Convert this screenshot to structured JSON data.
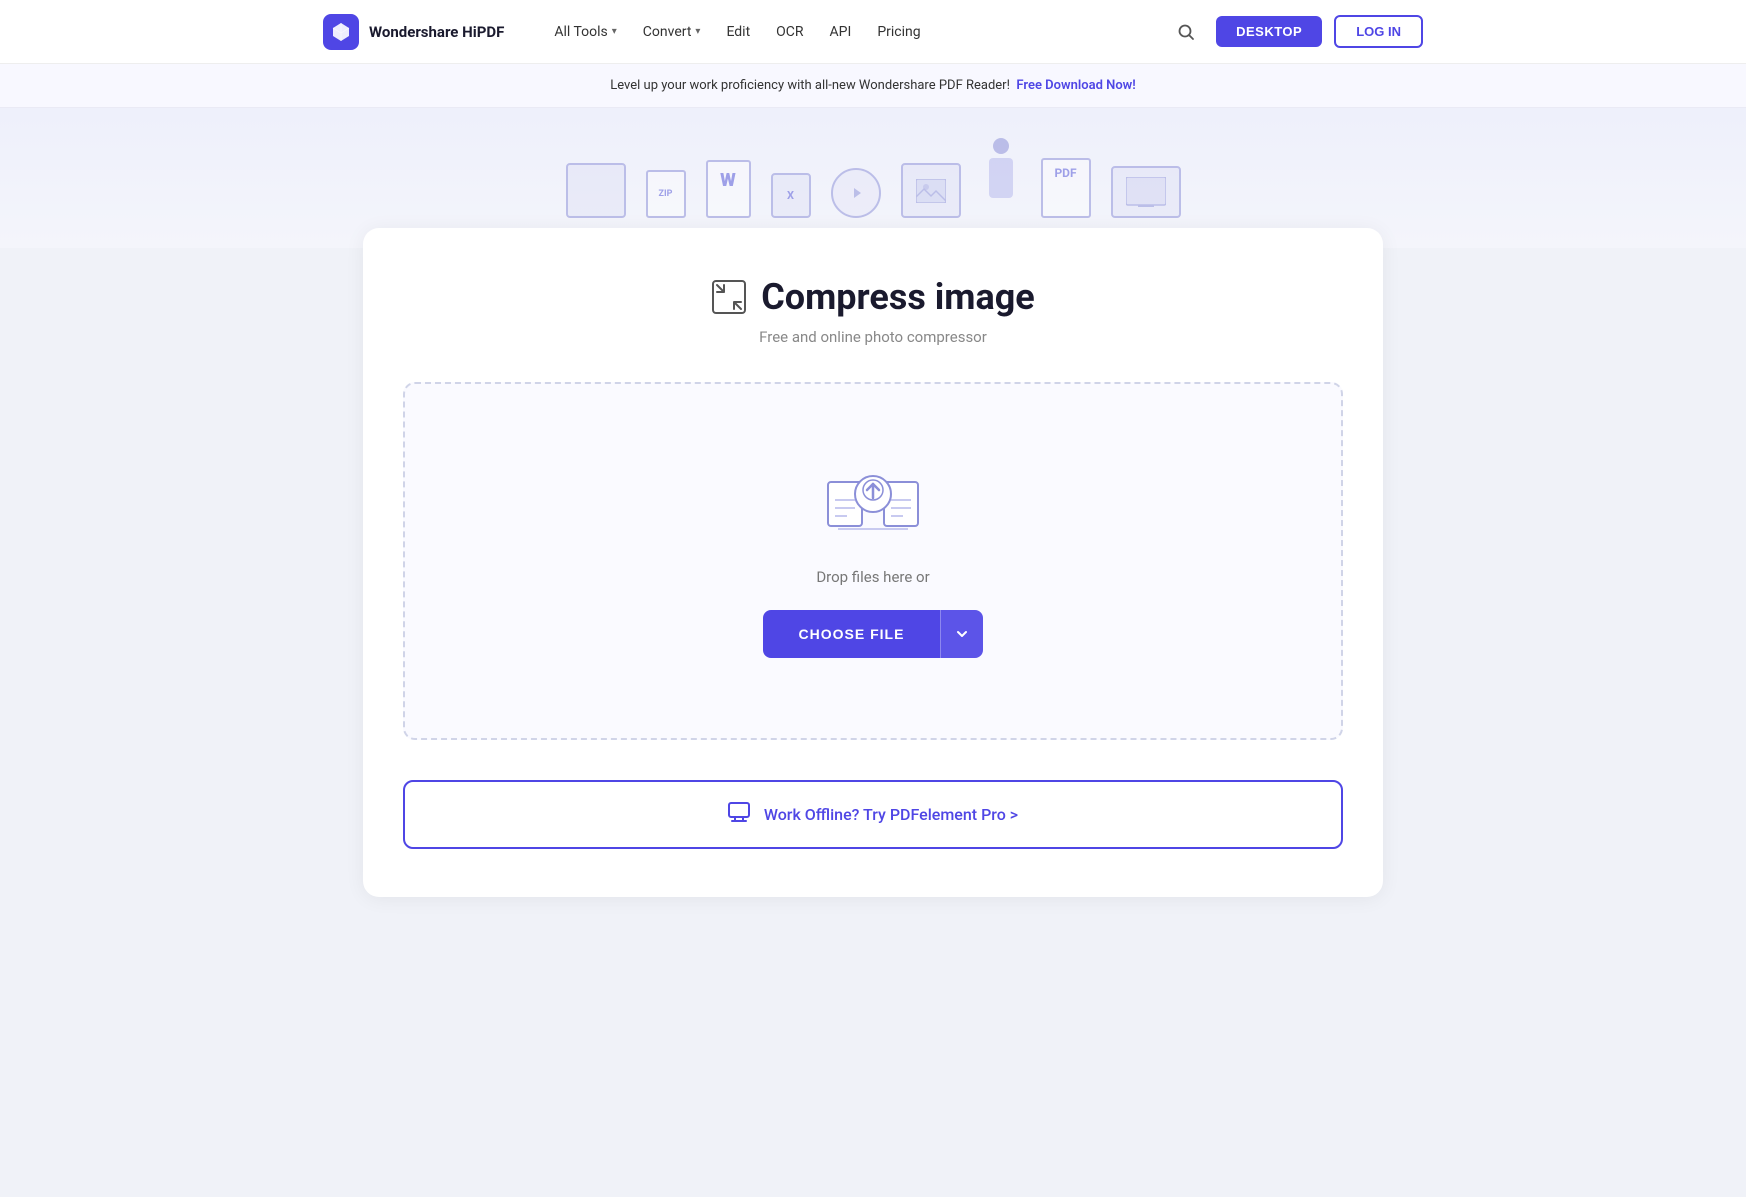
{
  "nav": {
    "logo_text": "Wondershare HiPDF",
    "links": [
      {
        "label": "All Tools",
        "has_chevron": true
      },
      {
        "label": "Convert",
        "has_chevron": true
      },
      {
        "label": "Edit",
        "has_chevron": false
      },
      {
        "label": "OCR",
        "has_chevron": false
      },
      {
        "label": "API",
        "has_chevron": false
      },
      {
        "label": "Pricing",
        "has_chevron": false
      }
    ],
    "desktop_btn": "DESKTOP",
    "login_btn": "LOG IN"
  },
  "banner": {
    "text": "Level up your work proficiency with all-new Wondershare PDF Reader!",
    "link_text": "Free Download Now!"
  },
  "tool": {
    "title": "Compress image",
    "subtitle": "Free and online photo compressor",
    "drop_text": "Drop files here or",
    "choose_file_label": "CHOOSE FILE"
  },
  "offline": {
    "text": "Work Offline? Try PDFelement Pro >"
  }
}
